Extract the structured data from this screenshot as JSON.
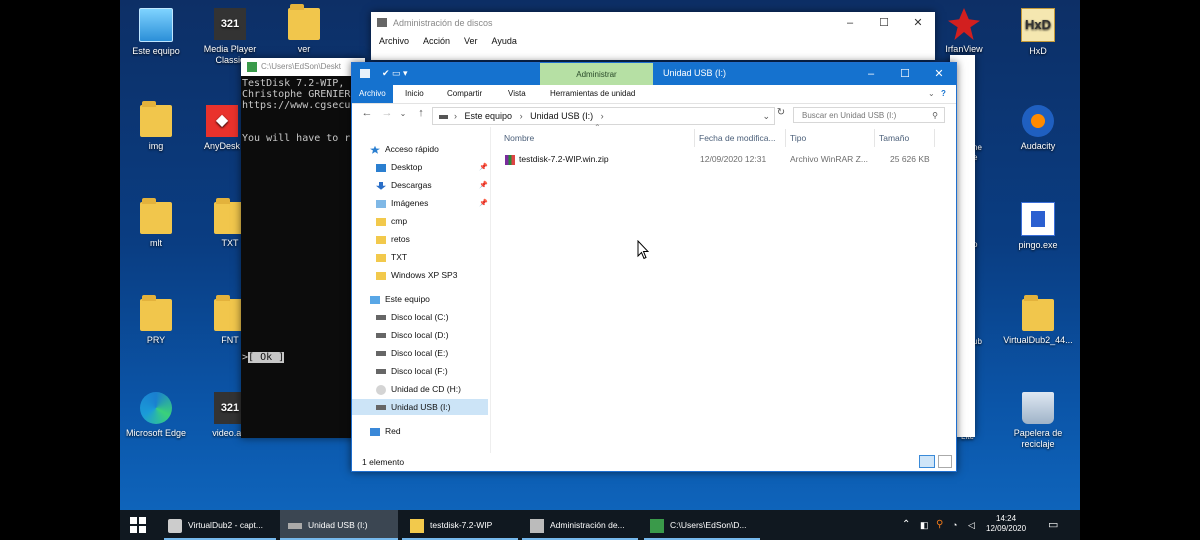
{
  "desktop_icons": [
    {
      "label": "Este equipo",
      "icon": "computer-icon"
    },
    {
      "label": "Media Player Classic",
      "icon": "media-player-icon"
    },
    {
      "label": "ver",
      "icon": "folder-icon"
    },
    {
      "label": "IrfanView",
      "icon": "irfanview-icon"
    },
    {
      "label": "HxD",
      "icon": "hxd-icon"
    },
    {
      "label": "img",
      "icon": "folder-icon"
    },
    {
      "label": "AnyDesk",
      "icon": "anydesk-icon"
    },
    {
      "label": "Audacity",
      "icon": "audacity-icon"
    },
    {
      "label": "mlt",
      "icon": "folder-icon"
    },
    {
      "label": "TXT",
      "icon": "folder-icon"
    },
    {
      "label": "pingo.exe",
      "icon": "pingo-icon"
    },
    {
      "label": "PRY",
      "icon": "folder-icon"
    },
    {
      "label": "FNT",
      "icon": "folder-icon"
    },
    {
      "label": "VirtualDub2_44...",
      "icon": "folder-icon"
    },
    {
      "label": "Microsoft Edge",
      "icon": "edge-icon"
    },
    {
      "label": "video.avi",
      "icon": "media-file-icon"
    },
    {
      "label": "Papelera de reciclaje",
      "icon": "recycle-bin-icon"
    }
  ],
  "partial_labels": {
    "a": "ne",
    "b": "e",
    "c": "o",
    "d": "ub",
    "e": "Lite"
  },
  "disk_window": {
    "title": "Administración de discos",
    "menu": [
      "Archivo",
      "Acción",
      "Ver",
      "Ayuda"
    ]
  },
  "console": {
    "title": "C:\\Users\\EdSon\\Deskt",
    "lines": [
      "TestDisk 7.2-WIP, ",
      "Christophe GRENIER",
      "https://www.cgsecu",
      "",
      "",
      "You will have to r"
    ],
    "ok_button": "[ Ok ]",
    "prompt": ">"
  },
  "explorer": {
    "title": "Unidad USB (I:)",
    "context_tab": "Administrar",
    "tabs": {
      "file": "Archivo",
      "home": "Inicio",
      "share": "Compartir",
      "view": "Vista",
      "tools": "Herramientas de unidad"
    },
    "breadcrumb": [
      "Este equipo",
      "Unidad USB (I:)"
    ],
    "search_placeholder": "Buscar en Unidad USB (I:)",
    "nav": {
      "quick_access": "Acceso rápido",
      "pinned": [
        "Desktop",
        "Descargas",
        "Imágenes"
      ],
      "folders": [
        "cmp",
        "retos",
        "TXT",
        "Windows XP SP3"
      ],
      "this_pc": "Este equipo",
      "drives": [
        "Disco local (C:)",
        "Disco local (D:)",
        "Disco local (E:)",
        "Disco local (F:)",
        "Unidad de CD (H:)",
        "Unidad USB (I:)"
      ],
      "network": "Red"
    },
    "columns": {
      "name": "Nombre",
      "date": "Fecha de modifica...",
      "type": "Tipo",
      "size": "Tamaño"
    },
    "files": [
      {
        "name": "testdisk-7.2-WIP.win.zip",
        "date": "12/09/2020 12:31",
        "type": "Archivo WinRAR Z...",
        "size": "25 626 KB"
      }
    ],
    "status": "1 elemento"
  },
  "taskbar": {
    "items": [
      "VirtualDub2 - capt...",
      "Unidad USB (I:)",
      "testdisk-7.2-WIP",
      "Administración de...",
      "C:\\Users\\EdSon\\D..."
    ],
    "time": "14:24",
    "date": "12/09/2020"
  }
}
